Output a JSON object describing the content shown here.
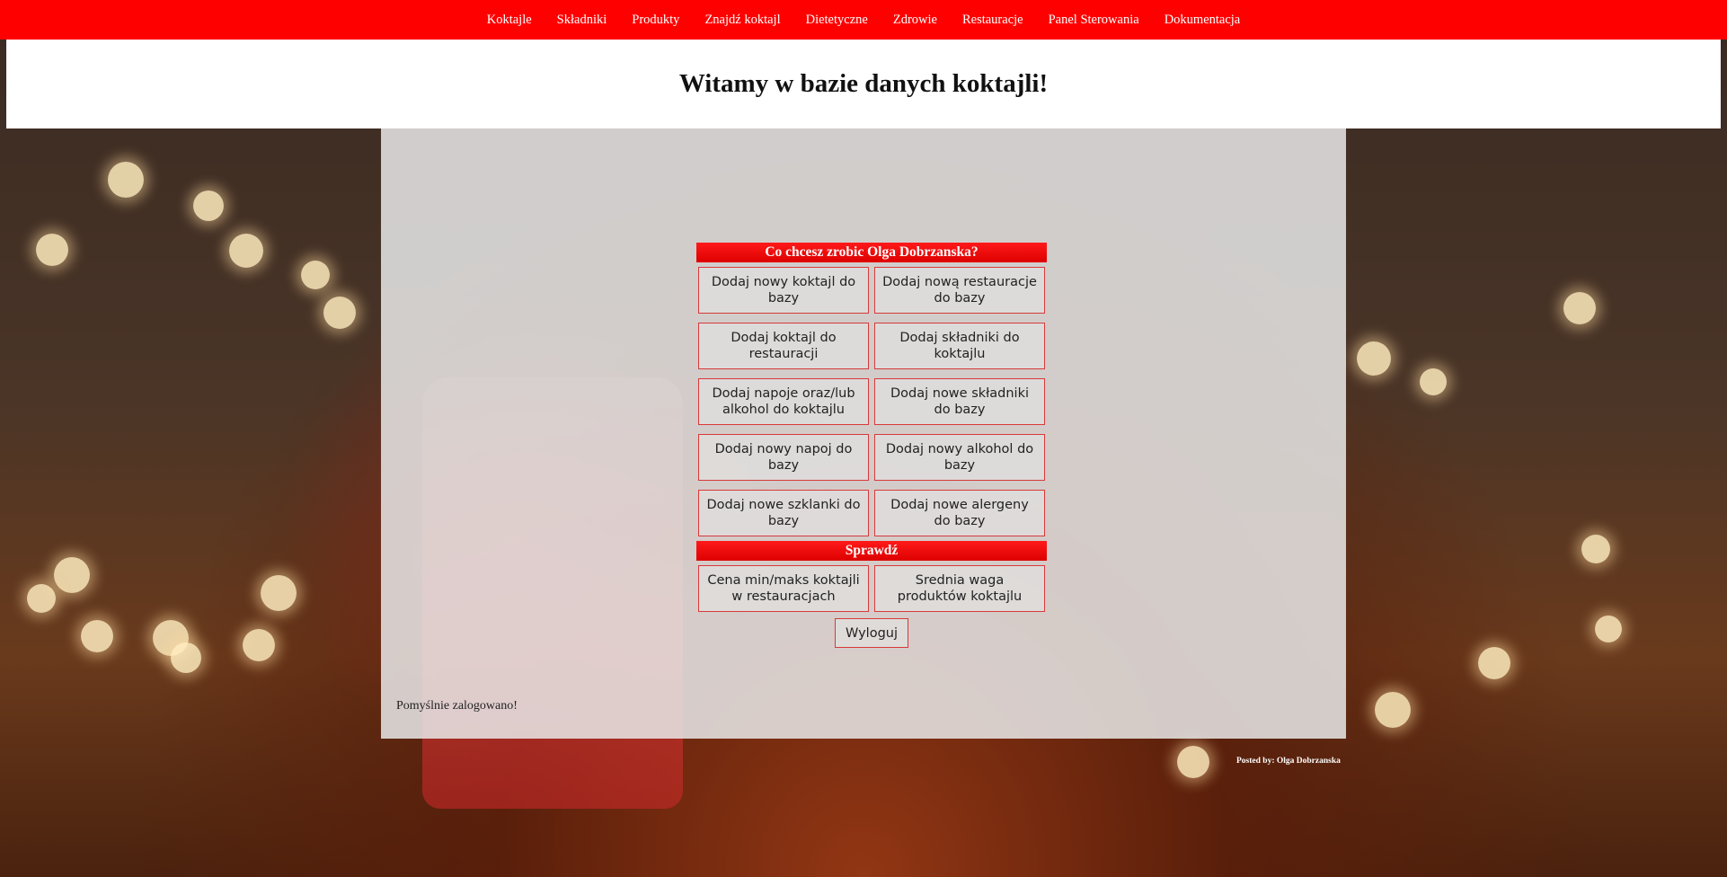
{
  "nav": {
    "items": [
      "Koktajle",
      "Składniki",
      "Produkty",
      "Znajdź koktajl",
      "Dietetyczne",
      "Zdrowie",
      "Restauracje",
      "Panel Sterowania",
      "Dokumentacja"
    ]
  },
  "header": {
    "title": "Witamy w bazie danych koktajli!"
  },
  "menu": {
    "heading": "Co chcesz zrobic Olga Dobrzanska?",
    "buttons": [
      "Dodaj nowy koktajl do bazy",
      "Dodaj nową restauracje do bazy",
      "Dodaj koktajl do restauracji",
      "Dodaj składniki do koktajlu",
      "Dodaj napoje oraz/lub alkohol do koktajlu",
      "Dodaj nowe składniki do bazy",
      "Dodaj nowy napoj do bazy",
      "Dodaj nowy alkohol do bazy",
      "Dodaj nowe szklanki do bazy",
      "Dodaj nowe alergeny do bazy"
    ],
    "check_heading": "Sprawdź",
    "check_buttons": [
      "Cena min/maks koktajli w restauracjach",
      "Srednia waga produktów koktajlu"
    ],
    "logout": "Wyloguj"
  },
  "status": "Pomyślnie zalogowano!",
  "footer": "Posted by: Olga Dobrzanska",
  "colors": {
    "nav_bg": "#ff0000",
    "accent": "#dd0000",
    "border": "#d63a3a"
  }
}
